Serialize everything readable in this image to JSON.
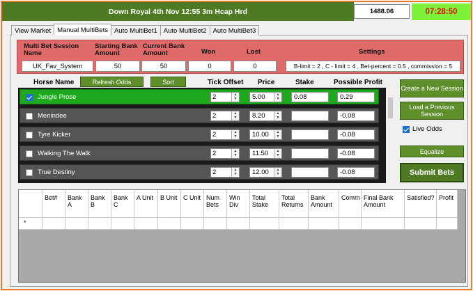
{
  "header": {
    "race_title": "Down Royal 4th Nov 12:55 3m Hcap Hrd",
    "bank_amount": "1488.06",
    "clock": "07:28:50"
  },
  "tabs": [
    {
      "label": "View Market"
    },
    {
      "label": "Manual MultiBets"
    },
    {
      "label": "Auto MultiBet1"
    },
    {
      "label": "Auto MultiBet2"
    },
    {
      "label": "Auto MultiBet3"
    }
  ],
  "session": {
    "name_label": "Multi Bet Session Name",
    "start_label": "Starting Bank Amount",
    "current_label": "Current Bank Amount",
    "won_label": "Won",
    "lost_label": "Lost",
    "settings_label": "Settings",
    "name_value": "UK_Fav_System",
    "start_value": "50",
    "current_value": "50",
    "won_value": "0",
    "lost_value": "0",
    "settings_value": "B-limit = 2 , C - limit = 4 , Bet-percent = 0.5 , commission = 5"
  },
  "horse_header": {
    "name": "Horse Name",
    "refresh": "Refresh Odds",
    "sort": "Sort",
    "tick": "Tick Offset",
    "price": "Price",
    "stake": "Stake",
    "profit": "Possible Profit"
  },
  "horses": [
    {
      "name": "Jungle Prose",
      "tick": "2",
      "price": "5.00",
      "stake": "0.08",
      "profit": "0.29",
      "selected": true
    },
    {
      "name": "Menindee",
      "tick": "2",
      "price": "8.20",
      "stake": "",
      "profit": "-0.08",
      "selected": false
    },
    {
      "name": "Tyre Kicker",
      "tick": "2",
      "price": "10.00",
      "stake": "",
      "profit": "-0.08",
      "selected": false
    },
    {
      "name": "Walking The Walk",
      "tick": "2",
      "price": "11.50",
      "stake": "",
      "profit": "-0.08",
      "selected": false
    },
    {
      "name": "True Destiny",
      "tick": "2",
      "price": "12.00",
      "stake": "",
      "profit": "-0.08",
      "selected": false
    }
  ],
  "side": {
    "create": "Create a New Session",
    "load": "Load a Previous Session",
    "live_odds": "Live Odds",
    "equalize": "Equalize",
    "submit": "Submit Bets"
  },
  "grid": {
    "columns": [
      "",
      "Bet#",
      "Bank A",
      "Bank B",
      "Bank C",
      "A Unit",
      "B Unit",
      "C Unit",
      "Num Bets",
      "Win Div",
      "Total Stake",
      "Total Returns",
      "Bank Amount",
      "Comm",
      "Final Bank Amount",
      "Satisfied?",
      "Profit"
    ],
    "new_row_marker": "*"
  }
}
